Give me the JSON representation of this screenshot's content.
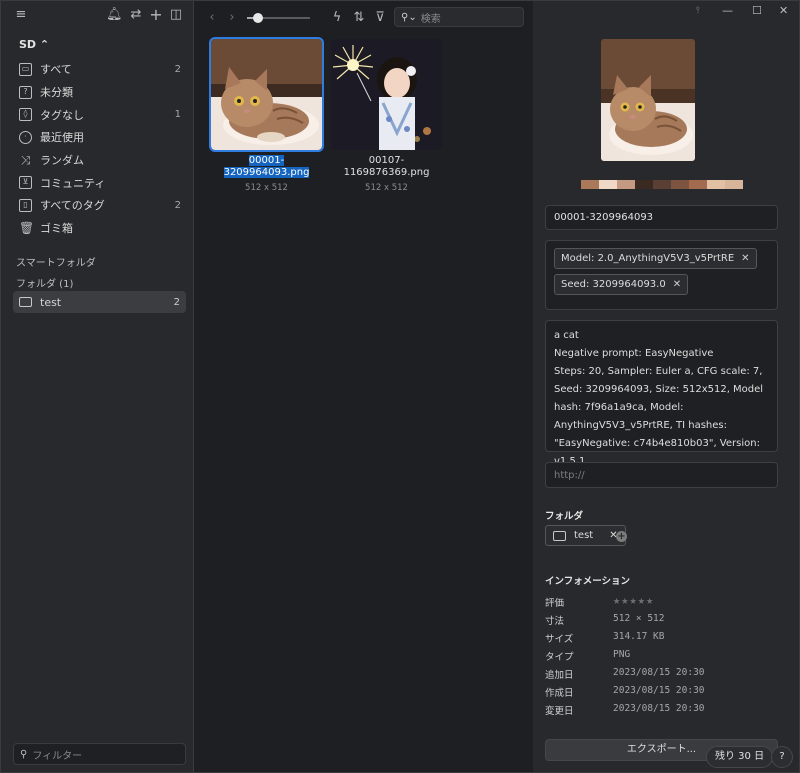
{
  "sidebar": {
    "library": "SD ⌃",
    "items": [
      {
        "label": "すべて",
        "count": "2",
        "icon": "inbox-icon"
      },
      {
        "label": "未分類",
        "count": "",
        "icon": "question-icon"
      },
      {
        "label": "タグなし",
        "count": "1",
        "icon": "tag-icon"
      },
      {
        "label": "最近使用",
        "count": "",
        "icon": "clock-icon"
      },
      {
        "label": "ランダム",
        "count": "",
        "icon": "shuffle-icon"
      },
      {
        "label": "コミュニティ",
        "count": "",
        "icon": "community-icon"
      },
      {
        "label": "すべてのタグ",
        "count": "2",
        "icon": "tags-icon"
      },
      {
        "label": "ゴミ箱",
        "count": "",
        "icon": "trash-icon"
      }
    ],
    "smart_folder": "スマートフォルダ",
    "folders_heading": "フォルダ (1)",
    "folder": {
      "label": "test",
      "count": "2"
    },
    "filter_placeholder": "フィルター"
  },
  "toolbar": {
    "search_placeholder": "検索",
    "zoom_level": 0.18
  },
  "items": [
    {
      "name_line1": "00001-",
      "name_line2": "3209964093.png",
      "size": "512 x 512",
      "selected": true
    },
    {
      "name_line1": "00107-",
      "name_line2": "1169876369.png",
      "size": "512 x 512",
      "selected": false
    }
  ],
  "inspector": {
    "filename": "00001-3209964093",
    "tags": [
      "Model: 2.0_AnythingV5V3_v5PrtRE",
      "Seed: 3209964093.0"
    ],
    "note": "a cat\nNegative prompt: EasyNegative\nSteps: 20, Sampler: Euler a, CFG scale: 7, Seed: 3209964093, Size: 512x512, Model hash: 7f96a1a9ca, Model: AnythingV5V3_v5PrtRE, TI hashes: \"EasyNegative: c74b4e810b03\", Version: v1.5.1",
    "url_placeholder": "http://",
    "folder_heading": "フォルダ",
    "folder_tag": "test",
    "info_heading": "インフォメーション",
    "info": [
      {
        "key": "評価",
        "value": ""
      },
      {
        "key": "寸法",
        "value": "512 × 512"
      },
      {
        "key": "サイズ",
        "value": "314.17 KB"
      },
      {
        "key": "タイプ",
        "value": "PNG"
      },
      {
        "key": "追加日",
        "value": "2023/08/15 20:30"
      },
      {
        "key": "作成日",
        "value": "2023/08/15 20:30"
      },
      {
        "key": "変更日",
        "value": "2023/08/15 20:30"
      }
    ],
    "rating": 0,
    "export_label": "エクスポート...",
    "trial_label": "残り 30 日",
    "help_label": "?",
    "palette": [
      "#a9795a",
      "#efd9c6",
      "#c49b82",
      "#3a2a22",
      "#5a4034",
      "#7c5440",
      "#a26a4e",
      "#e2c0a4",
      "#d8b49a"
    ]
  },
  "window": {
    "min": "—",
    "max": "☐",
    "close": "✕",
    "pin": "⫯"
  }
}
